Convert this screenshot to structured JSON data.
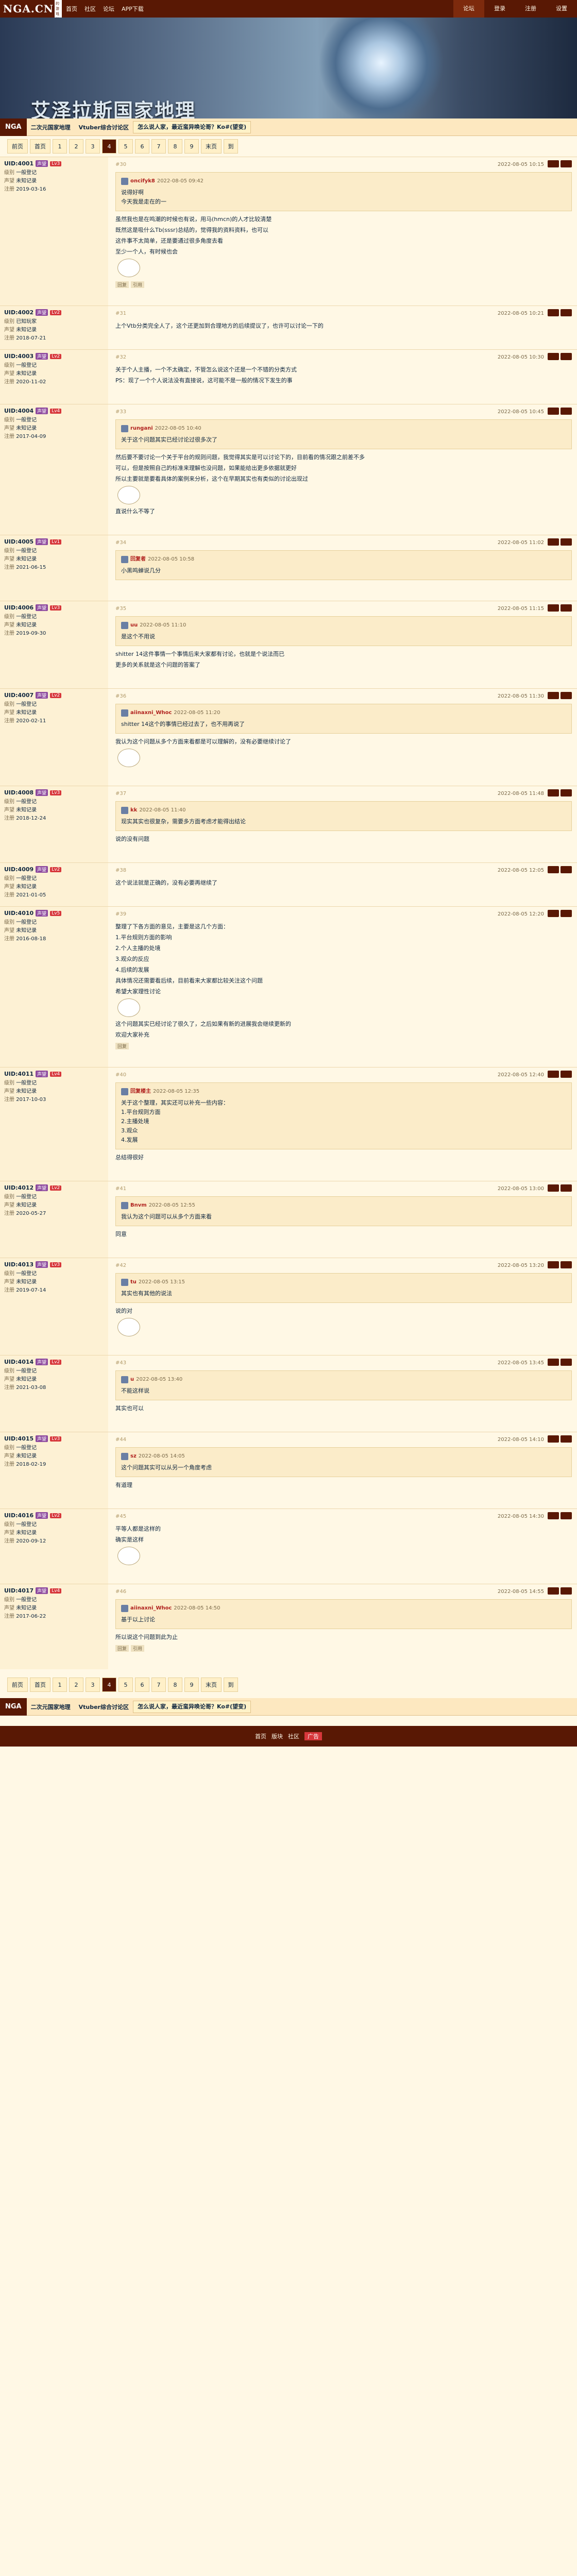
{
  "header": {
    "logo": "NGA.CN",
    "logo_sub": "最大的游戏社区",
    "nav": [
      "首页",
      "社区",
      "论坛",
      "APP下载"
    ],
    "right": [
      "论坛",
      "登录",
      "注册",
      "设置"
    ]
  },
  "banner": {
    "title": "艾泽拉斯国家地理"
  },
  "subnav": {
    "home": "NGA",
    "items": [
      "二次元国家地理",
      "Vtuber综合讨论区",
      "怎么说人家，最近蛮异唤论哥？Ko#(望变)"
    ]
  },
  "pager": {
    "prev": "前页",
    "first": "首页",
    "pages": [
      "1",
      "2",
      "3",
      "4",
      "5",
      "6",
      "7",
      "8",
      "9"
    ],
    "current": "4",
    "last": "末页",
    "to": "到"
  },
  "posts": [
    {
      "user": "UID:4001",
      "level": "Lv3",
      "badge": "声望",
      "stats": [
        [
          "级别",
          "一般登记"
        ],
        [
          "声望",
          "未知记录"
        ],
        [
          "注册",
          "2019-03-16"
        ]
      ],
      "floor": "#30",
      "time": "2022-08-05 10:15",
      "quote_user": "oncifyk8",
      "quote_time": "2022-08-05 09:42",
      "quote_lines": [
        "说得好啊",
        "今天我是走在的一"
      ],
      "lines": [
        "虽然我也是在鸣潮的时候也有说，用马(hmcn)的人才比较清楚",
        "既然这是吸什么Tb(sssr)总结的，觉得我的资料资料，也可以",
        "这件事不太简单，还是要通过很多角度去看",
        "至少一个人，有时候也会"
      ],
      "tags": [
        "回复",
        "引用"
      ]
    },
    {
      "user": "UID:4002",
      "level": "Lv2",
      "badge": "声望",
      "stats": [
        [
          "级别",
          "已知玩家"
        ],
        [
          "声望",
          "未知记录"
        ],
        [
          "注册",
          "2018-07-21"
        ]
      ],
      "floor": "#31",
      "time": "2022-08-05 10:21",
      "lines": [
        "上个Vtb分类完全人了，这个还更加到合理地方的后续提议了，也许可以讨论一下的"
      ],
      "tags": []
    },
    {
      "user": "UID:4003",
      "level": "Lv2",
      "badge": "声望",
      "stats": [
        [
          "级别",
          "一般登记"
        ],
        [
          "声望",
          "未知记录"
        ],
        [
          "注册",
          "2020-11-02"
        ]
      ],
      "floor": "#32",
      "time": "2022-08-05 10:30",
      "lines": [
        "关于个人主播，一个不太确定，不管怎么说这个还是一个不错的分类方式",
        "PS：现了一个个人说法没有直接说，这可能不是一般的情况下发生的事"
      ],
      "tags": []
    },
    {
      "user": "UID:4004",
      "level": "Lv4",
      "badge": "声望",
      "stats": [
        [
          "级别",
          "一般登记"
        ],
        [
          "声望",
          "未知记录"
        ],
        [
          "注册",
          "2017-04-09"
        ]
      ],
      "floor": "#33",
      "time": "2022-08-05 10:45",
      "lines": [
        "然后要不要讨论一个关于平台的规则问题，我觉得其实是可以讨论下的，目前看的情况跟之前差不多",
        "可以，但是按照自己的标准来理解也没问题，如果能给出更多依据就更好",
        "所以主要就是要看具体的案例来分析，这个在早期其实也有类似的讨论出现过"
      ],
      "quote_user": "rungani",
      "quote_time": "2022-08-05 10:40",
      "quote_lines": [
        "关于这个问题其实已经讨论过很多次了"
      ],
      "lines2": [
        "直说什么不等了"
      ],
      "tags": []
    },
    {
      "user": "UID:4005",
      "level": "Lv1",
      "badge": "声望",
      "stats": [
        [
          "级别",
          "一般登记"
        ],
        [
          "声望",
          "未知记录"
        ],
        [
          "注册",
          "2021-06-15"
        ]
      ],
      "floor": "#34",
      "time": "2022-08-05 11:02",
      "quote_user": "回复者",
      "quote_time": "2022-08-05 10:58",
      "quote_lines": [
        "小黑鸣蝉说几分"
      ],
      "lines": [],
      "tags": []
    },
    {
      "user": "UID:4006",
      "level": "Lv3",
      "badge": "声望",
      "stats": [
        [
          "级别",
          "一般登记"
        ],
        [
          "声望",
          "未知记录"
        ],
        [
          "注册",
          "2019-09-30"
        ]
      ],
      "floor": "#35",
      "time": "2022-08-05 11:15",
      "lines": [
        "shitter 14这件事情一个事情后来大家都有讨论，也就是个说法而已"
      ],
      "quote_user": "uu",
      "quote_time": "2022-08-05 11:10",
      "quote_lines": [
        "是这个不用说"
      ],
      "lines2": [
        "更多的关系就是这个问题的答案了"
      ],
      "tags": []
    },
    {
      "user": "UID:4007",
      "level": "Lv2",
      "badge": "声望",
      "stats": [
        [
          "级别",
          "一般登记"
        ],
        [
          "声望",
          "未知记录"
        ],
        [
          "注册",
          "2020-02-11"
        ]
      ],
      "floor": "#36",
      "time": "2022-08-05 11:30",
      "quote_user": "aiinaxni_Whoc",
      "quote_time": "2022-08-05 11:20",
      "quote_lines": [
        "shitter 14这个的事情已经过去了，也不用再说了"
      ],
      "lines": [
        "我认为这个问题从多个方面来看都是可以理解的，没有必要继续讨论了"
      ],
      "tags": []
    },
    {
      "user": "UID:4008",
      "level": "Lv3",
      "badge": "声望",
      "stats": [
        [
          "级别",
          "一般登记"
        ],
        [
          "声望",
          "未知记录"
        ],
        [
          "注册",
          "2018-12-24"
        ]
      ],
      "floor": "#37",
      "time": "2022-08-05 11:48",
      "quote_user": "kk",
      "quote_time": "2022-08-05 11:40",
      "quote_lines": [
        "现实其实也很复杂，需要多方面考虑才能得出结论"
      ],
      "lines": [
        "说的没有问题"
      ],
      "tags": []
    },
    {
      "user": "UID:4009",
      "level": "Lv2",
      "badge": "声望",
      "stats": [
        [
          "级别",
          "一般登记"
        ],
        [
          "声望",
          "未知记录"
        ],
        [
          "注册",
          "2021-01-05"
        ]
      ],
      "floor": "#38",
      "time": "2022-08-05 12:05",
      "lines": [
        "这个说法就是正确的，没有必要再继续了"
      ],
      "tags": []
    },
    {
      "user": "UID:4010",
      "level": "Lv5",
      "badge": "声望",
      "stats": [
        [
          "级别",
          "一般登记"
        ],
        [
          "声望",
          "未知记录"
        ],
        [
          "注册",
          "2016-08-18"
        ]
      ],
      "floor": "#39",
      "time": "2022-08-05 12:20",
      "lines": [
        "整理了下各方面的意见，主要是这几个方面：",
        "1.平台规则方面的影响",
        "2.个人主播的处境",
        "3.观众的反应",
        "4.后续的发展",
        "具体情况还需要看后续，目前看来大家都比较关注这个问题",
        "希望大家理性讨论"
      ],
      "lines2": [
        "这个问题其实已经讨论了很久了，之后如果有新的进展我会继续更新的",
        "欢迎大家补充"
      ],
      "tags": [
        "回复"
      ]
    },
    {
      "user": "UID:4011",
      "level": "Lv4",
      "badge": "声望",
      "stats": [
        [
          "级别",
          "一般登记"
        ],
        [
          "声望",
          "未知记录"
        ],
        [
          "注册",
          "2017-10-03"
        ]
      ],
      "floor": "#40",
      "time": "2022-08-05 12:40",
      "quote_user": "回复楼主",
      "quote_time": "2022-08-05 12:35",
      "quote_lines": [
        "关于这个整理，其实还可以补充一些内容：",
        "1.平台规则方面",
        "2.主播处境",
        "3.观众",
        "4.发展"
      ],
      "lines": [
        "总结得很好"
      ],
      "tags": []
    },
    {
      "user": "UID:4012",
      "level": "Lv2",
      "badge": "声望",
      "stats": [
        [
          "级别",
          "一般登记"
        ],
        [
          "声望",
          "未知记录"
        ],
        [
          "注册",
          "2020-05-27"
        ]
      ],
      "floor": "#41",
      "time": "2022-08-05 13:00",
      "quote_user": "Bnvm",
      "quote_time": "2022-08-05 12:55",
      "quote_lines": [
        "我认为这个问题可以从多个方面来看"
      ],
      "lines": [
        "同意"
      ],
      "tags": []
    },
    {
      "user": "UID:4013",
      "level": "Lv3",
      "badge": "声望",
      "stats": [
        [
          "级别",
          "一般登记"
        ],
        [
          "声望",
          "未知记录"
        ],
        [
          "注册",
          "2019-07-14"
        ]
      ],
      "floor": "#42",
      "time": "2022-08-05 13:20",
      "quote_user": "tu",
      "quote_time": "2022-08-05 13:15",
      "quote_lines": [
        "其实也有其他的说法"
      ],
      "lines": [
        "说的对"
      ],
      "tags": []
    },
    {
      "user": "UID:4014",
      "level": "Lv2",
      "badge": "声望",
      "stats": [
        [
          "级别",
          "一般登记"
        ],
        [
          "声望",
          "未知记录"
        ],
        [
          "注册",
          "2021-03-08"
        ]
      ],
      "floor": "#43",
      "time": "2022-08-05 13:45",
      "quote_user": "u",
      "quote_time": "2022-08-05 13:40",
      "quote_lines": [
        "不能这样说"
      ],
      "lines": [
        "其实也可以"
      ],
      "tags": []
    },
    {
      "user": "UID:4015",
      "level": "Lv3",
      "badge": "声望",
      "stats": [
        [
          "级别",
          "一般登记"
        ],
        [
          "声望",
          "未知记录"
        ],
        [
          "注册",
          "2018-02-19"
        ]
      ],
      "floor": "#44",
      "time": "2022-08-05 14:10",
      "quote_user": "sz",
      "quote_time": "2022-08-05 14:05",
      "quote_lines": [
        "这个问题其实可以从另一个角度考虑"
      ],
      "lines": [
        "有道理"
      ],
      "tags": []
    },
    {
      "user": "UID:4016",
      "level": "Lv2",
      "badge": "声望",
      "stats": [
        [
          "级别",
          "一般登记"
        ],
        [
          "声望",
          "未知记录"
        ],
        [
          "注册",
          "2020-09-12"
        ]
      ],
      "floor": "#45",
      "time": "2022-08-05 14:30",
      "lines": [
        "平等人都是这样的",
        "确实是这样"
      ],
      "tags": []
    },
    {
      "user": "UID:4017",
      "level": "Lv4",
      "badge": "声望",
      "stats": [
        [
          "级别",
          "一般登记"
        ],
        [
          "声望",
          "未知记录"
        ],
        [
          "注册",
          "2017-06-22"
        ]
      ],
      "floor": "#46",
      "time": "2022-08-05 14:55",
      "quote_user": "aiinaxni_Whoc",
      "quote_time": "2022-08-05 14:50",
      "quote_lines": [
        "基于以上讨论"
      ],
      "lines": [
        "所以说这个问题到此为止"
      ],
      "tags": [
        "回复",
        "引用"
      ]
    }
  ],
  "footer": {
    "links": [
      "首页",
      "版块",
      "社区"
    ],
    "ad": "广告"
  }
}
